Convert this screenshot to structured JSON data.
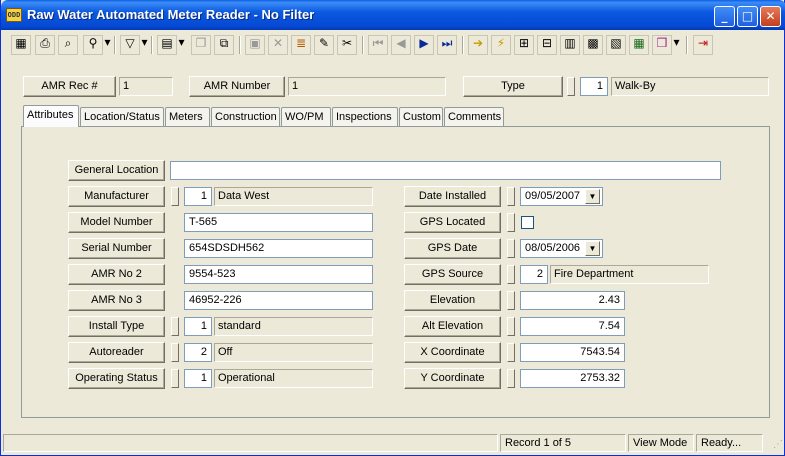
{
  "window": {
    "title": "Raw Water Automated Meter Reader - No Filter",
    "app_icon_text": "ODD"
  },
  "header": {
    "amr_rec_label": "AMR Rec #",
    "amr_rec_value": "1",
    "amr_number_label": "AMR Number",
    "amr_number_value": "1",
    "type_label": "Type",
    "type_code": "1",
    "type_value": "Walk-By"
  },
  "tabs": [
    "Attributes",
    "Location/Status",
    "Meters",
    "Construction",
    "WO/PM",
    "Inspections",
    "Custom",
    "Comments"
  ],
  "left": {
    "general_location": {
      "label": "General Location",
      "value": ""
    },
    "manufacturer": {
      "label": "Manufacturer",
      "code": "1",
      "value": "Data West"
    },
    "model_number": {
      "label": "Model Number",
      "value": "T-565"
    },
    "serial_number": {
      "label": "Serial Number",
      "value": "654SDSDH562"
    },
    "amr_no2": {
      "label": "AMR No 2",
      "value": "9554-523"
    },
    "amr_no3": {
      "label": "AMR No 3",
      "value": "46952-226"
    },
    "install_type": {
      "label": "Install Type",
      "code": "1",
      "value": "standard"
    },
    "autoreader": {
      "label": "Autoreader",
      "code": "2",
      "value": "Off"
    },
    "operating_status": {
      "label": "Operating Status",
      "code": "1",
      "value": "Operational"
    }
  },
  "right": {
    "date_installed": {
      "label": "Date Installed",
      "value": "09/05/2007"
    },
    "gps_located": {
      "label": "GPS Located",
      "checked": false
    },
    "gps_date": {
      "label": "GPS Date",
      "value": "08/05/2006"
    },
    "gps_source": {
      "label": "GPS Source",
      "code": "2",
      "value": "Fire Department"
    },
    "elevation": {
      "label": "Elevation",
      "value": "2.43"
    },
    "alt_elevation": {
      "label": "Alt Elevation",
      "value": "7.54"
    },
    "x_coordinate": {
      "label": "X Coordinate",
      "value": "7543.54"
    },
    "y_coordinate": {
      "label": "Y Coordinate",
      "value": "2753.32"
    }
  },
  "status": {
    "record": "Record 1 of 5",
    "mode": "View Mode",
    "state": "Ready..."
  }
}
